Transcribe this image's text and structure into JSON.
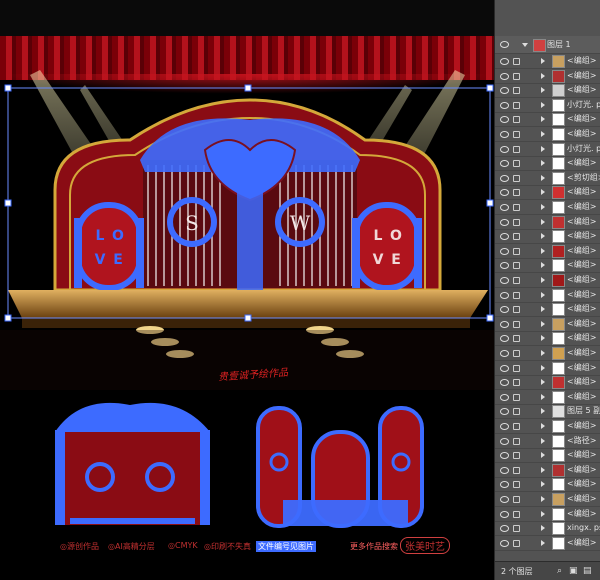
{
  "canvas": {
    "sign_text": "贵壹诚予绘作品",
    "monograms": [
      "S",
      "W"
    ],
    "love_text": [
      "L",
      "O",
      "V",
      "E"
    ],
    "watermarks": [
      {
        "text": "◎源创作品",
        "color": "#b0302a"
      },
      {
        "text": "◎AI高精分层",
        "color": "#b0302a"
      },
      {
        "text": "◎CMYK",
        "color": "#b0302a"
      },
      {
        "text": "◎印刷不失真",
        "color": "#b0302a"
      },
      {
        "text": "文件编号见图片",
        "color": "#d04040"
      },
      {
        "text": "更多作品搜索",
        "color": "#d04040"
      },
      {
        "text": "张美时艺",
        "color": "#d04040"
      }
    ],
    "colors": {
      "selection": "#3d6bff",
      "gold": "#d4a83a",
      "red": "#a01018"
    }
  },
  "layers_panel": {
    "top_layer": "图层 1",
    "rows": [
      {
        "label": "<编组>",
        "swatch": "#c8a060"
      },
      {
        "label": "<编组>",
        "swatch": "#b03030"
      },
      {
        "label": "<编组>",
        "swatch": "#d0d0d0"
      },
      {
        "label": "小灯光. ps",
        "swatch": "#ffffff"
      },
      {
        "label": "<编组>",
        "swatch": "#ffffff"
      },
      {
        "label": "<编组>",
        "swatch": "#ffffff"
      },
      {
        "label": "小灯光. ps",
        "swatch": "#ffffff"
      },
      {
        "label": "<编组>",
        "swatch": "#ffffff"
      },
      {
        "label": "<剪切组>",
        "swatch": "#ffffff"
      },
      {
        "label": "<编组>",
        "swatch": "#d03030"
      },
      {
        "label": "<编组>",
        "swatch": "#ffffff"
      },
      {
        "label": "<编组>",
        "swatch": "#c03030"
      },
      {
        "label": "<编组>",
        "swatch": "#ffffff"
      },
      {
        "label": "<编组>",
        "swatch": "#b02020"
      },
      {
        "label": "<编组>",
        "swatch": "#ffffff"
      },
      {
        "label": "<编组>",
        "swatch": "#a01818"
      },
      {
        "label": "<编组>",
        "swatch": "#ffffff"
      },
      {
        "label": "<编组>",
        "swatch": "#ffffff"
      },
      {
        "label": "<编组>",
        "swatch": "#c8a060"
      },
      {
        "label": "<编组>",
        "swatch": "#ffffff"
      },
      {
        "label": "<编组>",
        "swatch": "#d0a050"
      },
      {
        "label": "<编组>",
        "swatch": "#ffffff"
      },
      {
        "label": "<编组>",
        "swatch": "#c03030"
      },
      {
        "label": "<编组>",
        "swatch": "#ffffff"
      },
      {
        "label": "图层 5 副本",
        "swatch": "#e0e0e0"
      },
      {
        "label": "<编组>",
        "swatch": "#ffffff"
      },
      {
        "label": "<路径>",
        "swatch": "#ffffff"
      },
      {
        "label": "<编组>",
        "swatch": "#ffffff"
      },
      {
        "label": "<编组>",
        "swatch": "#b03030"
      },
      {
        "label": "<编组>",
        "swatch": "#ffffff"
      },
      {
        "label": "<编组>",
        "swatch": "#c8a060"
      },
      {
        "label": "<编组>",
        "swatch": "#ffffff"
      },
      {
        "label": "xingx. psd",
        "swatch": "#ffffff"
      },
      {
        "label": "<编组>",
        "swatch": "#ffffff"
      }
    ],
    "footer_label": "2 个图层"
  }
}
